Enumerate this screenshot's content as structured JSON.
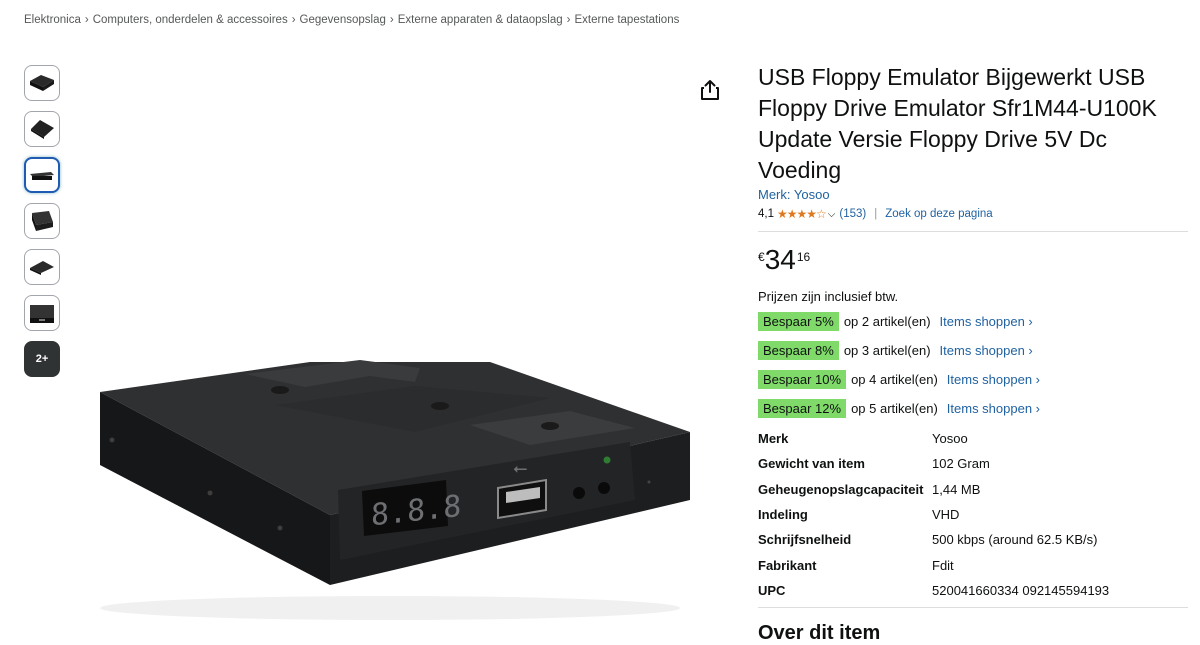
{
  "breadcrumb": [
    "Elektronica",
    "Computers, onderdelen & accessoires",
    "Gegevensopslag",
    "Externe apparaten & dataopslag",
    "Externe tapestations"
  ],
  "breadcrumb_separator": "›",
  "thumbnails": {
    "more_label": "2+"
  },
  "product": {
    "title": "USB Floppy Emulator Bijgewerkt USB Floppy Drive Emulator Sfr1M44-U100K Update Versie Floppy Drive 5V Dc Voeding",
    "brand_link": "Merk: Yosoo",
    "rating_value": "4,1",
    "stars": "★★★★☆",
    "rating_chevron": "⌵",
    "review_count": "(153)",
    "search_page": "Zoek op deze pagina",
    "price_symbol": "€",
    "price_whole": "34",
    "price_fraction": "16",
    "tax_note": "Prijzen zijn inclusief btw."
  },
  "promos": [
    {
      "badge": "Bespaar 5%",
      "text": "op 2 artikel(en)",
      "link": "Items shoppen ›"
    },
    {
      "badge": "Bespaar 8%",
      "text": "op 3 artikel(en)",
      "link": "Items shoppen ›"
    },
    {
      "badge": "Bespaar 10%",
      "text": "op 4 artikel(en)",
      "link": "Items shoppen ›"
    },
    {
      "badge": "Bespaar 12%",
      "text": "op 5 artikel(en)",
      "link": "Items shoppen ›"
    }
  ],
  "specs": [
    {
      "key": "Merk",
      "value": "Yosoo"
    },
    {
      "key": "Gewicht van item",
      "value": "102 Gram"
    },
    {
      "key": "Geheugenopslagcapaciteit",
      "value": "1,44 MB"
    },
    {
      "key": "Indeling",
      "value": "VHD"
    },
    {
      "key": "Schrijfsnelheid",
      "value": "500 kbps (around 62.5 KB/s)"
    },
    {
      "key": "Fabrikant",
      "value": "Fdit"
    },
    {
      "key": "UPC",
      "value": "520041660334 092145594193"
    }
  ],
  "about_heading": "Over dit item",
  "device": {
    "display_text": "8.8.8",
    "usb_symbol": "⭠"
  },
  "colors": {
    "link": "#2162A1",
    "star": "#DE7921",
    "badge": "#7FDA69",
    "selected_thumb": "#1f5ab3"
  }
}
